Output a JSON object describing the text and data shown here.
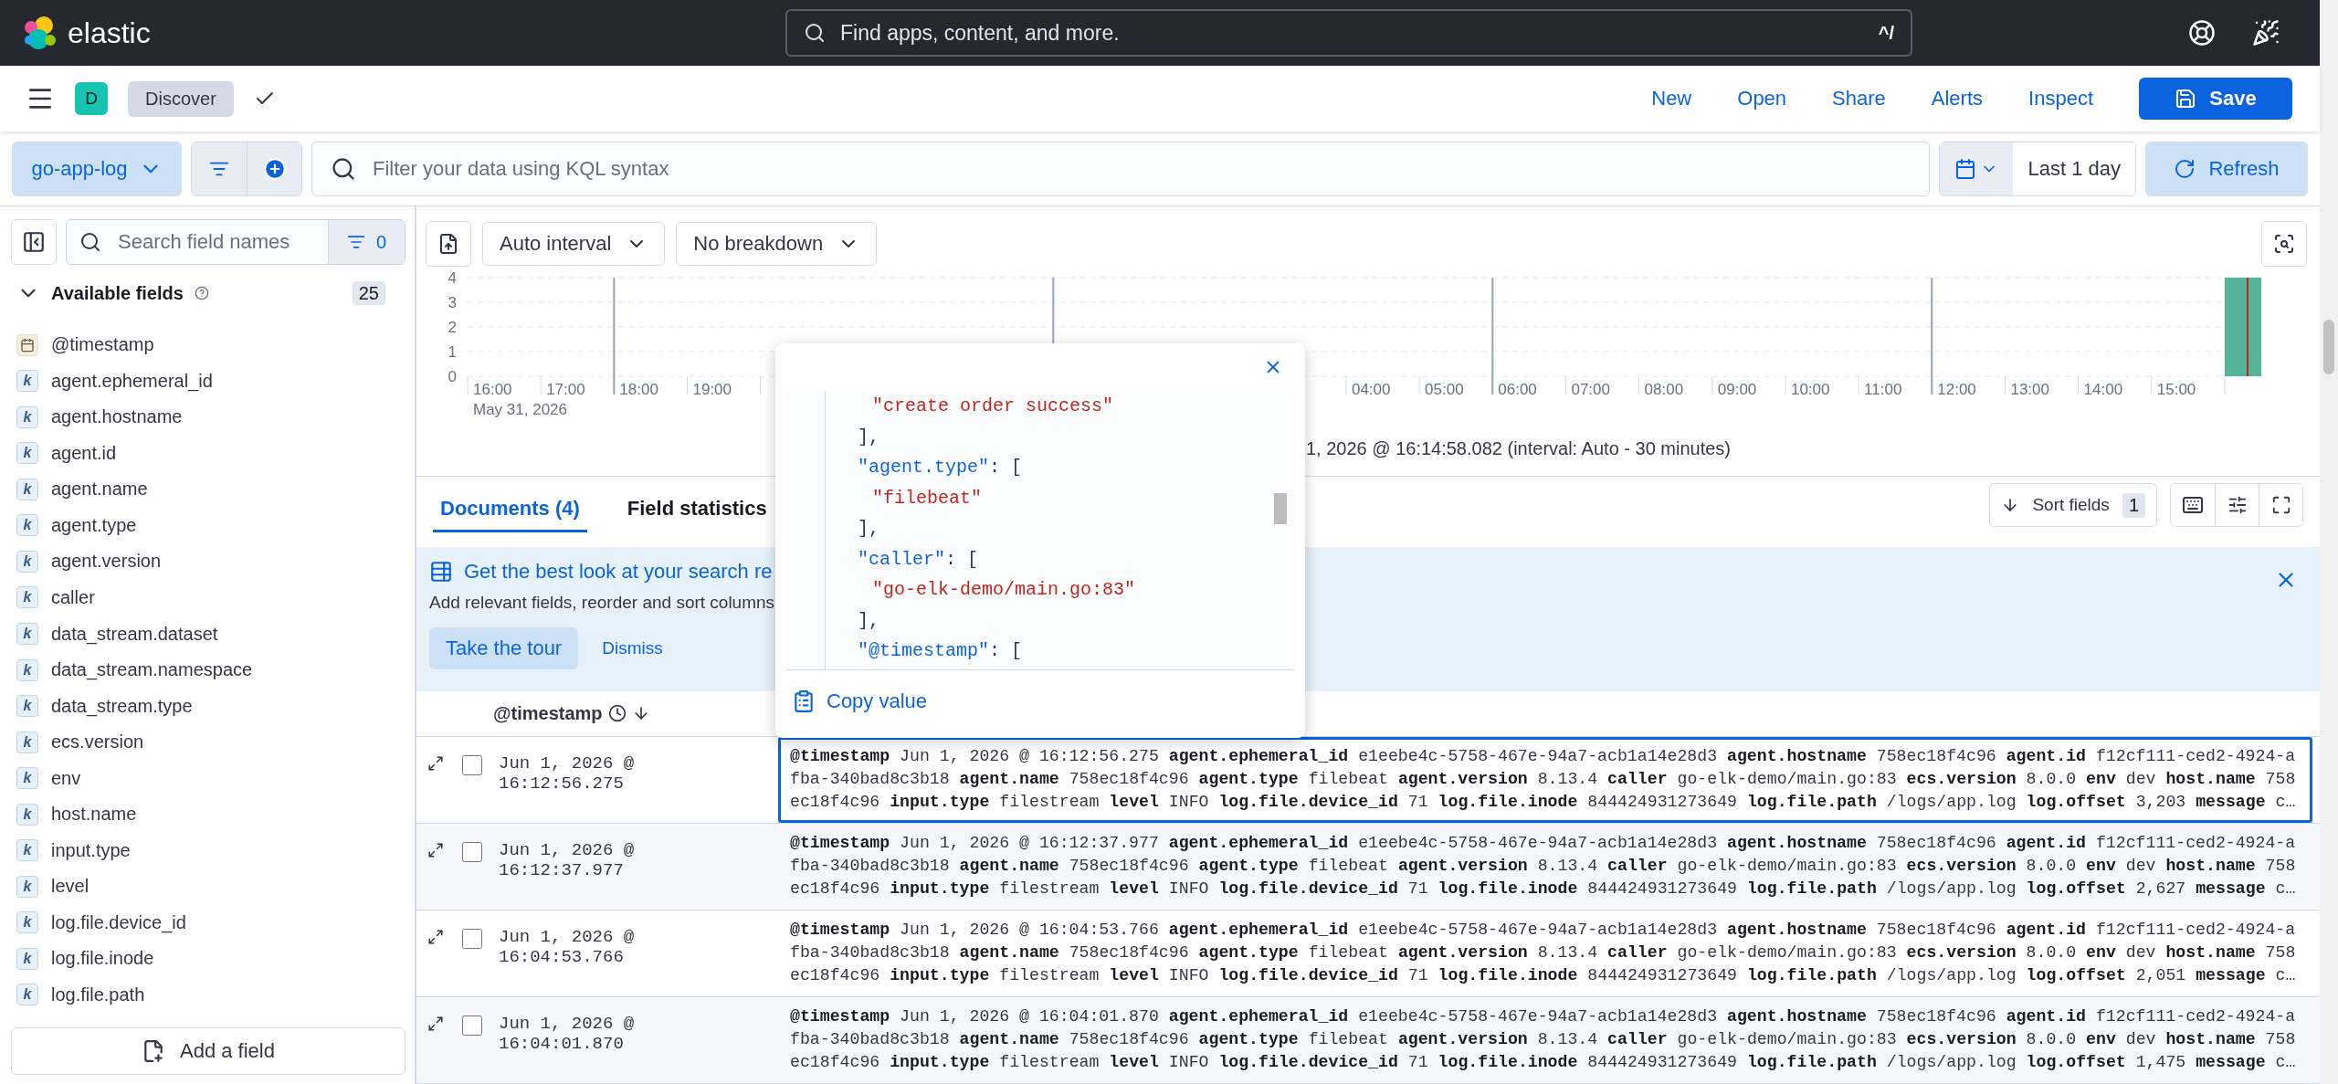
{
  "header": {
    "logo_text": "elastic",
    "search_placeholder": "Find apps, content, and more.",
    "shortcut": "^/"
  },
  "app_bar": {
    "space_initial": "D",
    "breadcrumb": "Discover",
    "menu": [
      "New",
      "Open",
      "Share",
      "Alerts",
      "Inspect"
    ],
    "save_label": "Save"
  },
  "query_bar": {
    "data_view": "go-app-log",
    "placeholder": "Filter your data using KQL syntax",
    "time_range": "Last 1 day",
    "refresh_label": "Refresh"
  },
  "sidebar": {
    "search_placeholder": "Search field names",
    "filter_count": "0",
    "section_title": "Available fields",
    "expanded": true,
    "field_count": "25",
    "fields": [
      {
        "name": "@timestamp",
        "kind": "date"
      },
      {
        "name": "agent.ephemeral_id",
        "kind": "keyword",
        "badge": "k"
      },
      {
        "name": "agent.hostname",
        "kind": "keyword",
        "badge": "k"
      },
      {
        "name": "agent.id",
        "kind": "keyword",
        "badge": "k"
      },
      {
        "name": "agent.name",
        "kind": "keyword",
        "badge": "k"
      },
      {
        "name": "agent.type",
        "kind": "keyword",
        "badge": "k"
      },
      {
        "name": "agent.version",
        "kind": "keyword",
        "badge": "k"
      },
      {
        "name": "caller",
        "kind": "keyword",
        "badge": "k"
      },
      {
        "name": "data_stream.dataset",
        "kind": "keyword",
        "badge": "k"
      },
      {
        "name": "data_stream.namespace",
        "kind": "keyword",
        "badge": "k"
      },
      {
        "name": "data_stream.type",
        "kind": "keyword",
        "badge": "k"
      },
      {
        "name": "ecs.version",
        "kind": "keyword",
        "badge": "k"
      },
      {
        "name": "env",
        "kind": "keyword",
        "badge": "k"
      },
      {
        "name": "host.name",
        "kind": "keyword",
        "badge": "k"
      },
      {
        "name": "input.type",
        "kind": "keyword",
        "badge": "k"
      },
      {
        "name": "level",
        "kind": "keyword",
        "badge": "k"
      },
      {
        "name": "log.file.device_id",
        "kind": "keyword",
        "badge": "k"
      },
      {
        "name": "log.file.inode",
        "kind": "keyword",
        "badge": "k"
      },
      {
        "name": "log.file.path",
        "kind": "keyword",
        "badge": "k"
      }
    ],
    "add_field_label": "Add a field"
  },
  "chart": {
    "interval": "Auto interval",
    "breakdown": "No breakdown",
    "date_label": "May 31, 2026",
    "caption": "1, 2026 @ 16:14:58.082 (interval: Auto - 30 minutes)",
    "chart_data": {
      "type": "bar",
      "grid": true,
      "ylim": [
        0,
        4
      ],
      "yticks": [
        0,
        1,
        2,
        3,
        4
      ],
      "categories": [
        "16:00",
        "17:00",
        "18:00",
        "19:00",
        null,
        null,
        null,
        null,
        null,
        null,
        null,
        null,
        "04:00",
        "05:00",
        "06:00",
        "07:00",
        "08:00",
        "09:00",
        "10:00",
        "11:00",
        "12:00",
        "13:00",
        "14:00",
        "15:00",
        null
      ],
      "values": [
        0,
        0,
        0,
        0,
        0,
        0,
        0,
        0,
        0,
        0,
        0,
        0,
        0,
        0,
        0,
        0,
        0,
        0,
        0,
        0,
        0,
        0,
        0,
        0,
        4
      ]
    }
  },
  "tabs": [
    {
      "label": "Documents (4)",
      "selected": true
    },
    {
      "label": "Field statistics",
      "selected": false
    }
  ],
  "sort_fields": {
    "label": "Sort fields",
    "count": "1"
  },
  "callout": {
    "title": "Get the best look at your search re",
    "text": "Add relevant fields, reorder and sort columns",
    "primary": "Take the tour",
    "secondary": "Dismiss"
  },
  "table": {
    "column": "@timestamp",
    "rows": [
      {
        "timestamp": "Jun 1, 2026 @ 16:12:56.275",
        "selected": true,
        "checked": false,
        "summary": [
          {
            "key": "@timestamp",
            "value": "Jun 1, 2026 @ 16:12:56.275"
          },
          {
            "key": "agent.ephemeral_id",
            "value": "e1eebe4c-5758-467e-94a7-acb1a14e28d3"
          },
          {
            "key": "agent.hostname",
            "value": "758ec18f4c96"
          },
          {
            "key": "agent.id",
            "value": "f12cf111-ced2-4924-afba-340bad8c3b18"
          },
          {
            "key": "agent.name",
            "value": "758ec18f4c96"
          },
          {
            "key": "agent.type",
            "value": "filebeat"
          },
          {
            "key": "agent.version",
            "value": "8.13.4"
          },
          {
            "key": "caller",
            "value": "go-elk-demo/main.go:83"
          },
          {
            "key": "ecs.version",
            "value": "8.0.0"
          },
          {
            "key": "env",
            "value": "dev"
          },
          {
            "key": "host.name",
            "value": "758ec18f4c96"
          },
          {
            "key": "input.type",
            "value": "filestream"
          },
          {
            "key": "level",
            "value": "INFO"
          },
          {
            "key": "log.file.device_id",
            "value": "71"
          },
          {
            "key": "log.file.inode",
            "value": "844424931273649"
          },
          {
            "key": "log.file.path",
            "value": "/logs/app.log"
          },
          {
            "key": "log.offset",
            "value": "3,203"
          },
          {
            "key": "message",
            "value": "c…"
          }
        ]
      },
      {
        "timestamp": "Jun 1, 2026 @ 16:12:37.977",
        "selected": false,
        "checked": false,
        "summary": [
          {
            "key": "@timestamp",
            "value": "Jun 1, 2026 @ 16:12:37.977"
          },
          {
            "key": "agent.ephemeral_id",
            "value": "e1eebe4c-5758-467e-94a7-acb1a14e28d3"
          },
          {
            "key": "agent.hostname",
            "value": "758ec18f4c96"
          },
          {
            "key": "agent.id",
            "value": "f12cf111-ced2-4924-afba-340bad8c3b18"
          },
          {
            "key": "agent.name",
            "value": "758ec18f4c96"
          },
          {
            "key": "agent.type",
            "value": "filebeat"
          },
          {
            "key": "agent.version",
            "value": "8.13.4"
          },
          {
            "key": "caller",
            "value": "go-elk-demo/main.go:83"
          },
          {
            "key": "ecs.version",
            "value": "8.0.0"
          },
          {
            "key": "env",
            "value": "dev"
          },
          {
            "key": "host.name",
            "value": "758ec18f4c96"
          },
          {
            "key": "input.type",
            "value": "filestream"
          },
          {
            "key": "level",
            "value": "INFO"
          },
          {
            "key": "log.file.device_id",
            "value": "71"
          },
          {
            "key": "log.file.inode",
            "value": "844424931273649"
          },
          {
            "key": "log.file.path",
            "value": "/logs/app.log"
          },
          {
            "key": "log.offset",
            "value": "2,627"
          },
          {
            "key": "message",
            "value": "c…"
          }
        ]
      },
      {
        "timestamp": "Jun 1, 2026 @ 16:04:53.766",
        "selected": false,
        "checked": false,
        "summary": [
          {
            "key": "@timestamp",
            "value": "Jun 1, 2026 @ 16:04:53.766"
          },
          {
            "key": "agent.ephemeral_id",
            "value": "e1eebe4c-5758-467e-94a7-acb1a14e28d3"
          },
          {
            "key": "agent.hostname",
            "value": "758ec18f4c96"
          },
          {
            "key": "agent.id",
            "value": "f12cf111-ced2-4924-afba-340bad8c3b18"
          },
          {
            "key": "agent.name",
            "value": "758ec18f4c96"
          },
          {
            "key": "agent.type",
            "value": "filebeat"
          },
          {
            "key": "agent.version",
            "value": "8.13.4"
          },
          {
            "key": "caller",
            "value": "go-elk-demo/main.go:83"
          },
          {
            "key": "ecs.version",
            "value": "8.0.0"
          },
          {
            "key": "env",
            "value": "dev"
          },
          {
            "key": "host.name",
            "value": "758ec18f4c96"
          },
          {
            "key": "input.type",
            "value": "filestream"
          },
          {
            "key": "level",
            "value": "INFO"
          },
          {
            "key": "log.file.device_id",
            "value": "71"
          },
          {
            "key": "log.file.inode",
            "value": "844424931273649"
          },
          {
            "key": "log.file.path",
            "value": "/logs/app.log"
          },
          {
            "key": "log.offset",
            "value": "2,051"
          },
          {
            "key": "message",
            "value": "c…"
          }
        ]
      },
      {
        "timestamp": "Jun 1, 2026 @ 16:04:01.870",
        "selected": false,
        "checked": false,
        "summary": [
          {
            "key": "@timestamp",
            "value": "Jun 1, 2026 @ 16:04:01.870"
          },
          {
            "key": "agent.ephemeral_id",
            "value": "e1eebe4c-5758-467e-94a7-acb1a14e28d3"
          },
          {
            "key": "agent.hostname",
            "value": "758ec18f4c96"
          },
          {
            "key": "agent.id",
            "value": "f12cf111-ced2-4924-afba-340bad8c3b18"
          },
          {
            "key": "agent.name",
            "value": "758ec18f4c96"
          },
          {
            "key": "agent.type",
            "value": "filebeat"
          },
          {
            "key": "agent.version",
            "value": "8.13.4"
          },
          {
            "key": "caller",
            "value": "go-elk-demo/main.go:83"
          },
          {
            "key": "ecs.version",
            "value": "8.0.0"
          },
          {
            "key": "env",
            "value": "dev"
          },
          {
            "key": "host.name",
            "value": "758ec18f4c96"
          },
          {
            "key": "input.type",
            "value": "filestream"
          },
          {
            "key": "level",
            "value": "INFO"
          },
          {
            "key": "log.file.device_id",
            "value": "71"
          },
          {
            "key": "log.file.inode",
            "value": "844424931273649"
          },
          {
            "key": "log.file.path",
            "value": "/logs/app.log"
          },
          {
            "key": "log.offset",
            "value": "1,475"
          },
          {
            "key": "message",
            "value": "c…"
          }
        ]
      }
    ]
  },
  "popover": {
    "lines": [
      {
        "kind": "value",
        "text": "\"create order success\""
      },
      {
        "kind": "close",
        "text": "],"
      },
      {
        "kind": "key",
        "key": "\"agent.type\"",
        "text": ": ["
      },
      {
        "kind": "value",
        "text": "\"filebeat\""
      },
      {
        "kind": "close",
        "text": "],"
      },
      {
        "kind": "key",
        "key": "\"caller\"",
        "text": ": ["
      },
      {
        "kind": "value",
        "text": "\"go-elk-demo/main.go:83\""
      },
      {
        "kind": "close",
        "text": "],"
      },
      {
        "kind": "key",
        "key": "\"@timestamp\"",
        "text": ": ["
      }
    ],
    "copy_label": "Copy value"
  }
}
